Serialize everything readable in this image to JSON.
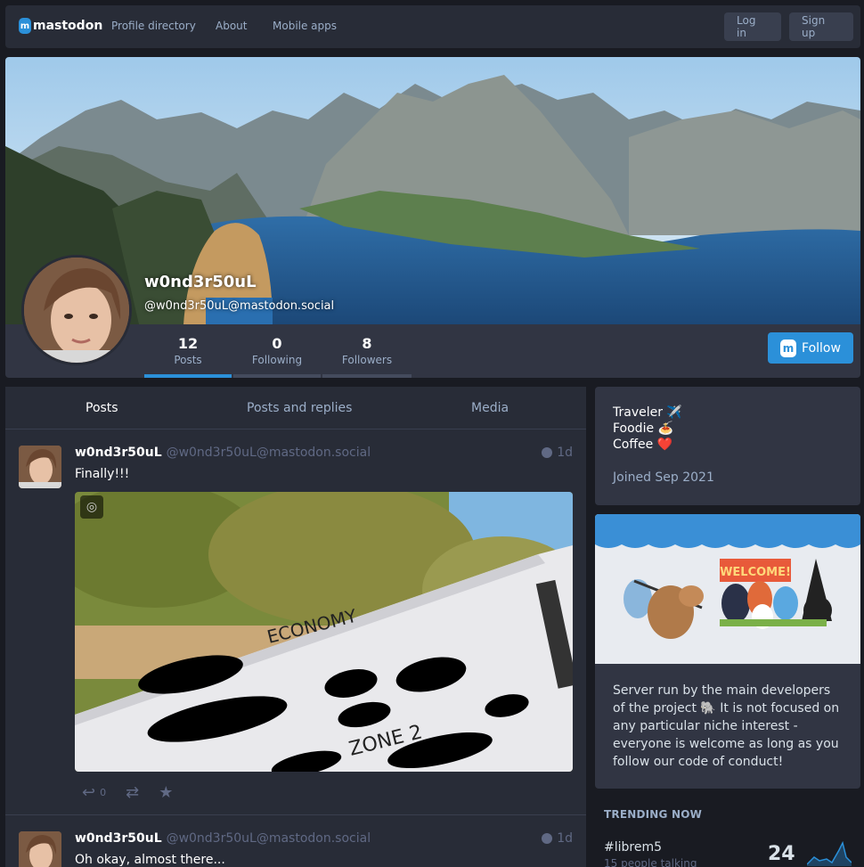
{
  "nav": {
    "logo_text": "mastodon",
    "logo_mark": "m",
    "links": [
      "Profile directory",
      "About",
      "Mobile apps"
    ],
    "login_label": "Log in",
    "signup_label": "Sign up"
  },
  "profile": {
    "display_name": "w0nd3r50uL",
    "handle": "@w0nd3r50uL@mastodon.social",
    "counters": [
      {
        "value": "12",
        "label": "Posts"
      },
      {
        "value": "0",
        "label": "Following"
      },
      {
        "value": "8",
        "label": "Followers"
      }
    ],
    "follow_label": "Follow",
    "follow_icon_letter": "m",
    "bio_lines": [
      "Traveler ✈️",
      "Foodie 🍝",
      "Coffee ❤️"
    ],
    "joined": "Joined Sep 2021"
  },
  "tabs": [
    "Posts",
    "Posts and replies",
    "Media"
  ],
  "statuses": [
    {
      "name": "w0nd3r50uL",
      "acct": "@w0nd3r50uL@mastodon.social",
      "time": "1d",
      "text": "Finally!!!",
      "media_text_economy": "ECONOMY",
      "media_text_zone": "ZONE 2",
      "reply_count": "0"
    },
    {
      "name": "w0nd3r50uL",
      "acct": "@w0nd3r50uL@mastodon.social",
      "time": "1d",
      "text": "Oh okay, almost there..."
    }
  ],
  "server": {
    "welcome_banner": "WELCOME!",
    "description": "Server run by the main developers of the project 🐘 It is not focused on any particular niche interest - everyone is welcome as long as you follow our code of conduct!"
  },
  "trending": {
    "title": "TRENDING NOW",
    "tag": "#librem5",
    "sub": "15 people talking",
    "count": "24"
  },
  "colors": {
    "accent": "#2b90d9",
    "bg": "#191b22",
    "card": "#282c37"
  }
}
